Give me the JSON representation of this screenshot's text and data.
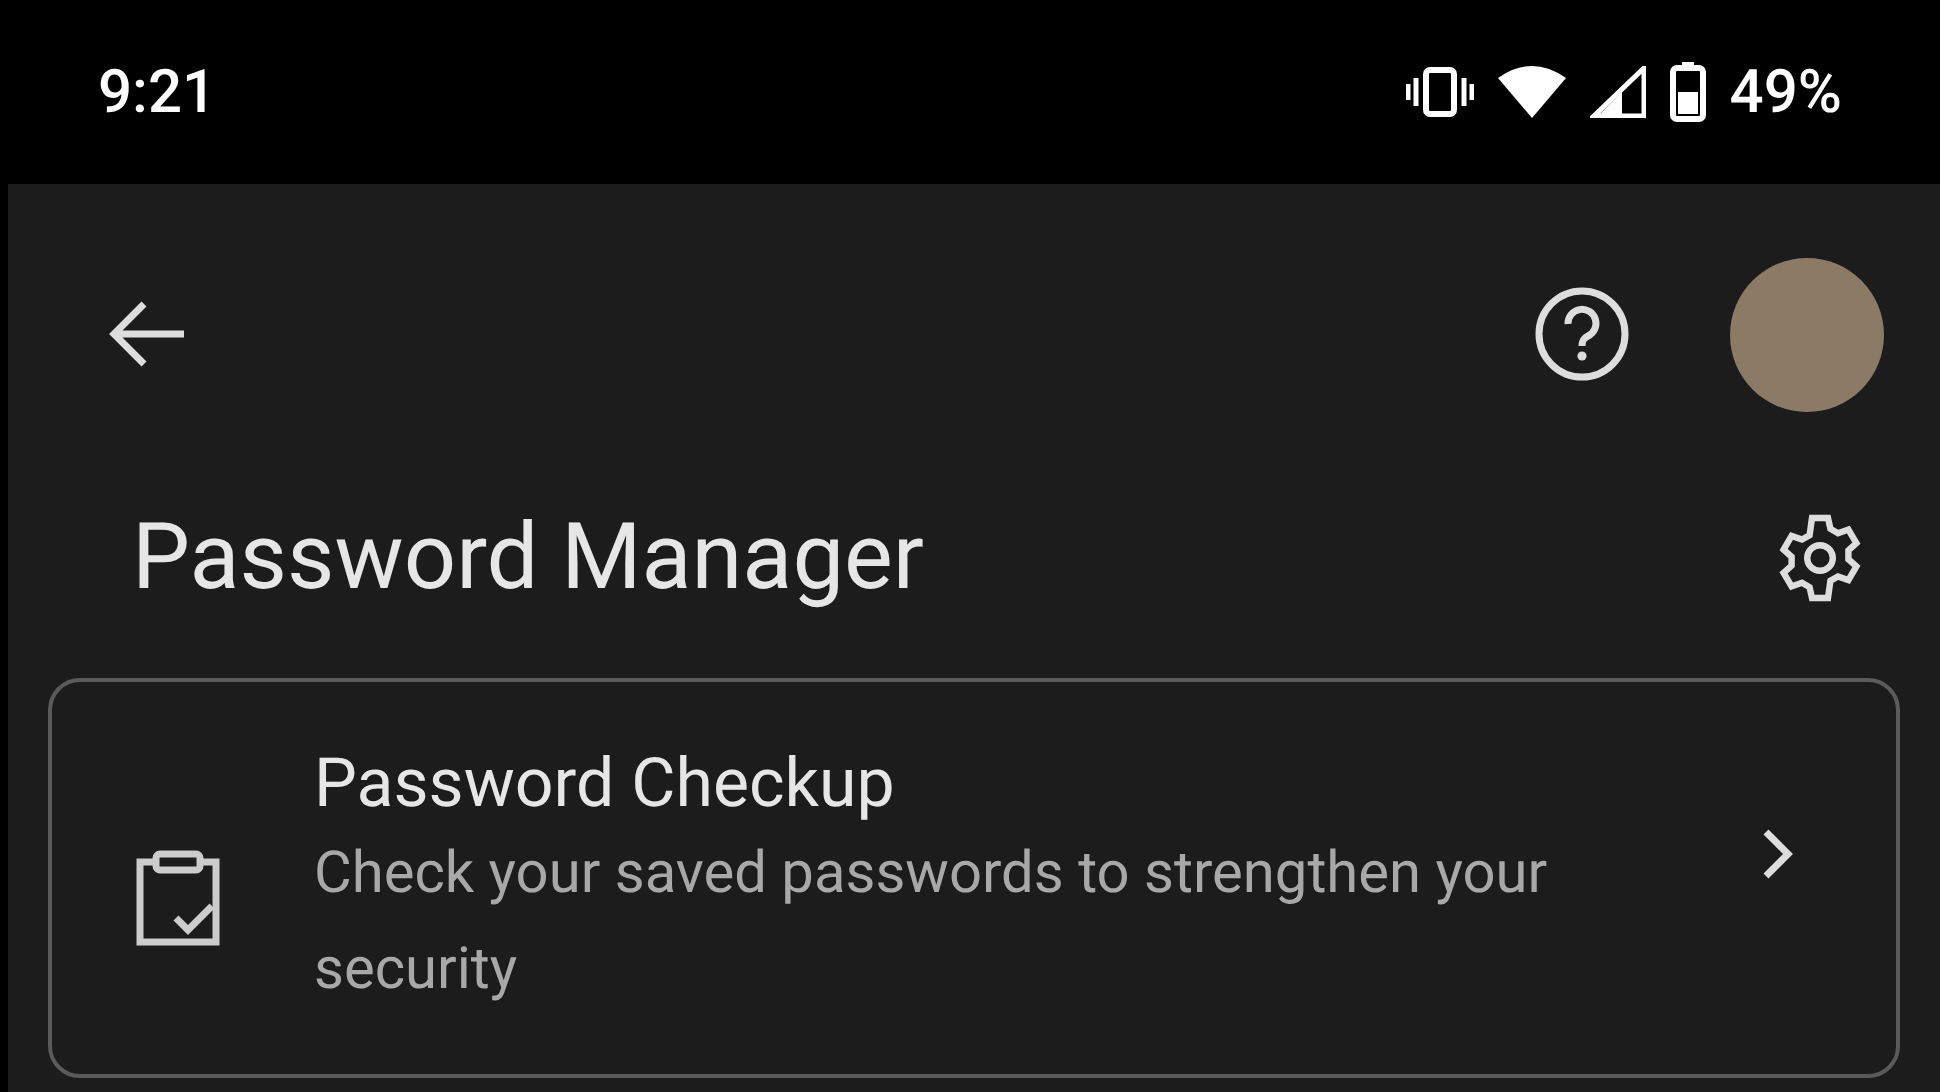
{
  "status_bar": {
    "time": "9:21",
    "battery": "49%"
  },
  "title": "Password Manager",
  "card": {
    "title": "Password Checkup",
    "description": "Check your saved passwords to strengthen your security"
  }
}
